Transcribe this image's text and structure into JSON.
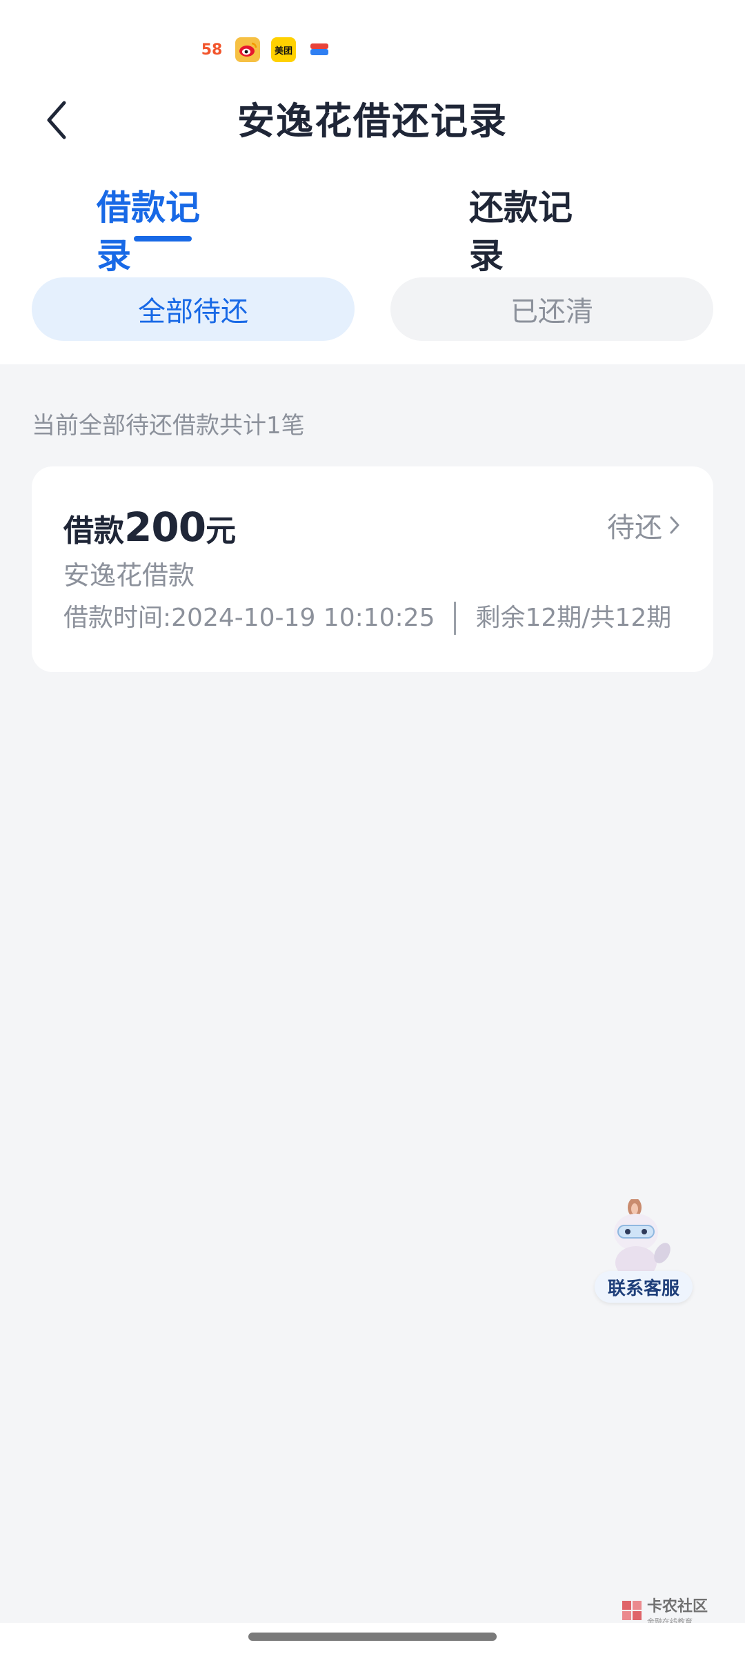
{
  "status_bar": {
    "icons": [
      {
        "name": "58-app-icon",
        "label": "58"
      },
      {
        "name": "weibo-app-icon",
        "label": ""
      },
      {
        "name": "meituan-app-icon",
        "label": "美团"
      },
      {
        "name": "wallet-app-icon",
        "label": ""
      }
    ]
  },
  "header": {
    "title": "安逸花借还记录",
    "back_icon": "chevron-left-icon"
  },
  "tabs": [
    {
      "label": "借款记录",
      "active": true
    },
    {
      "label": "还款记录",
      "active": false
    }
  ],
  "filters": [
    {
      "label": "全部待还",
      "active": true
    },
    {
      "label": "已还清",
      "active": false
    }
  ],
  "summary": "当前全部待还借款共计1笔",
  "loans": [
    {
      "title_prefix": "借款",
      "amount": "200",
      "unit": "元",
      "status": "待还",
      "product": "安逸花借款",
      "time": "借款时间:2024-10-19 10:10:25",
      "installments": "剩余12期/共12期"
    }
  ],
  "customer_service": {
    "label": "联系客服"
  },
  "watermark": {
    "text": "卡农社区",
    "sub": "金融在线教育"
  },
  "colors": {
    "accent": "#1869e6",
    "text": "#1f2637",
    "muted": "#8c919b",
    "background": "#f4f5f7"
  }
}
